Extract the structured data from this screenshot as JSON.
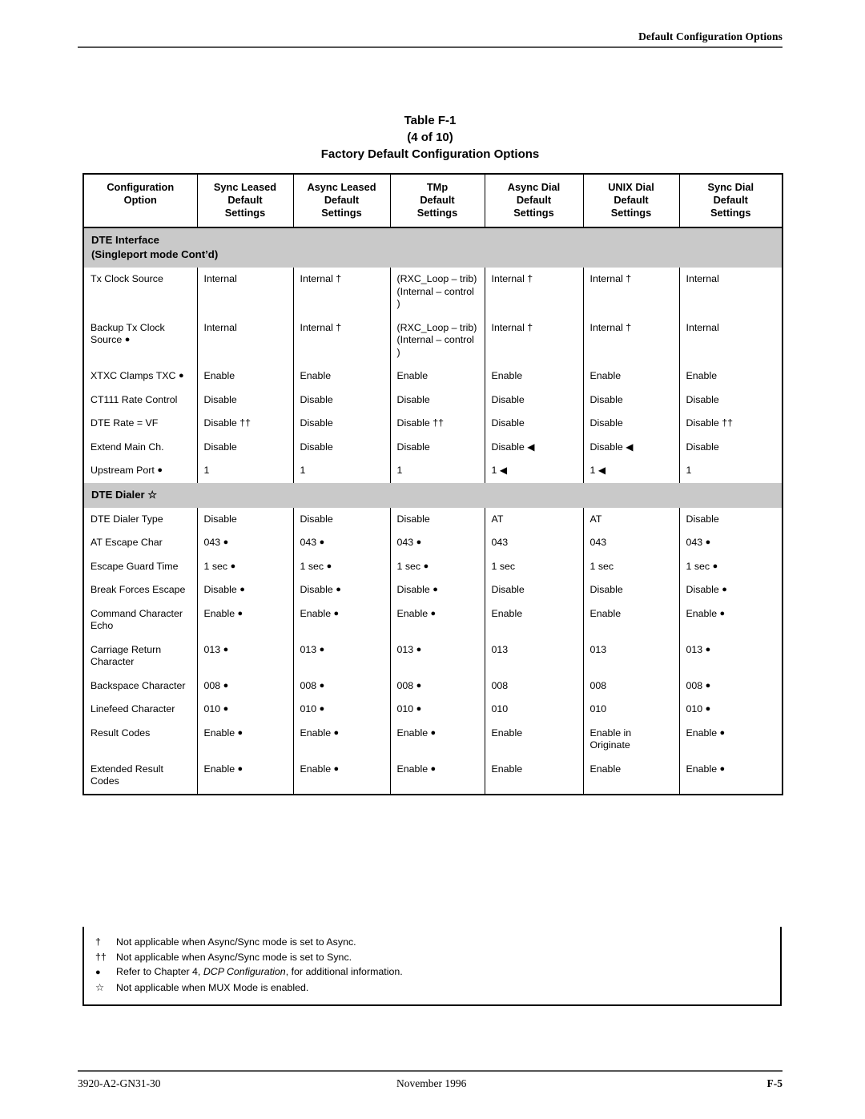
{
  "page": {
    "running_header": "Default Configuration Options",
    "footer": {
      "doc_number": "3920-A2-GN31-30",
      "date": "November 1996",
      "page_number": "F-5"
    }
  },
  "table": {
    "title_line1": "Table F-1",
    "title_line2": "(4 of 10)",
    "title_line3": "Factory Default Configuration Options",
    "columns": [
      "Configuration\nOption",
      "Sync Leased\nDefault\nSettings",
      "Async Leased\nDefault\nSettings",
      "TMp\nDefault\nSettings",
      "Async Dial\nDefault\nSettings",
      "UNIX Dial\nDefault\nSettings",
      "Sync Dial\nDefault\nSettings"
    ],
    "columns_flat": [
      {
        "l1": "Configuration",
        "l2": "Option",
        "l3": ""
      },
      {
        "l1": "Sync Leased",
        "l2": "Default",
        "l3": "Settings"
      },
      {
        "l1": "Async Leased",
        "l2": "Default",
        "l3": "Settings"
      },
      {
        "l1": "TMp",
        "l2": "Default",
        "l3": "Settings"
      },
      {
        "l1": "Async Dial",
        "l2": "Default",
        "l3": "Settings"
      },
      {
        "l1": "UNIX Dial",
        "l2": "Default",
        "l3": "Settings"
      },
      {
        "l1": "Sync Dial",
        "l2": "Default",
        "l3": "Settings"
      }
    ],
    "sections": [
      {
        "heading_line1": "DTE Interface",
        "heading_line2": "(Singleport mode Cont’d)",
        "rows": [
          {
            "option": "Tx Clock Source",
            "cells": [
              "Internal",
              "Internal †",
              "(RXC_Loop – trib)\n(Internal – control )",
              "Internal †",
              "Internal †",
              "Internal"
            ]
          },
          {
            "option": "Backup Tx Clock Source ●",
            "cells": [
              "Internal",
              "Internal †",
              "(RXC_Loop – trib)\n(Internal – control )",
              "Internal †",
              "Internal †",
              "Internal"
            ]
          },
          {
            "option": "XTXC Clamps TXC ●",
            "cells": [
              "Enable",
              "Enable",
              "Enable",
              "Enable",
              "Enable",
              "Enable"
            ]
          },
          {
            "option": "CT111 Rate Control",
            "cells": [
              "Disable",
              "Disable",
              "Disable",
              "Disable",
              "Disable",
              "Disable"
            ]
          },
          {
            "option": "DTE Rate = VF",
            "cells": [
              "Disable ††",
              "Disable",
              "Disable ††",
              "Disable",
              "Disable",
              "Disable ††"
            ]
          },
          {
            "option": "Extend Main Ch.",
            "cells": [
              "Disable",
              "Disable",
              "Disable",
              "Disable ◀",
              "Disable ◀",
              "Disable"
            ]
          },
          {
            "option": "Upstream Port ●",
            "cells": [
              "1",
              "1",
              "1",
              "1 ◀",
              "1 ◀",
              "1"
            ]
          }
        ]
      },
      {
        "heading_line1": "DTE Dialer ☆",
        "heading_line2": "",
        "rows": [
          {
            "option": "DTE Dialer Type",
            "cells": [
              "Disable",
              "Disable",
              "Disable",
              "AT",
              "AT",
              "Disable"
            ]
          },
          {
            "option": "AT Escape Char",
            "cells": [
              "043 ●",
              "043 ●",
              "043 ●",
              "043",
              "043",
              "043 ●"
            ]
          },
          {
            "option": "Escape Guard Time",
            "cells": [
              "1 sec ●",
              "1 sec ●",
              "1 sec ●",
              "1 sec",
              "1 sec",
              "1 sec ●"
            ]
          },
          {
            "option": "Break Forces Escape",
            "cells": [
              "Disable ●",
              "Disable ●",
              "Disable ●",
              "Disable",
              "Disable",
              "Disable ●"
            ]
          },
          {
            "option": "Command Character Echo",
            "cells": [
              "Enable ●",
              "Enable ●",
              "Enable ●",
              "Enable",
              "Enable",
              "Enable ●"
            ]
          },
          {
            "option": "Carriage Return Character",
            "cells": [
              "013 ●",
              "013 ●",
              "013 ●",
              "013",
              "013",
              "013 ●"
            ]
          },
          {
            "option": "Backspace Character",
            "cells": [
              "008 ●",
              "008 ●",
              "008 ●",
              "008",
              "008",
              "008 ●"
            ]
          },
          {
            "option": "Linefeed Character",
            "cells": [
              "010 ●",
              "010 ●",
              "010 ●",
              "010",
              "010",
              "010 ●"
            ]
          },
          {
            "option": "Result Codes",
            "cells": [
              "Enable ●",
              "Enable ●",
              "Enable ●",
              "Enable",
              "Enable in Originate",
              "Enable ●"
            ]
          },
          {
            "option": "Extended Result Codes",
            "cells": [
              "Enable ●",
              "Enable ●",
              "Enable ●",
              "Enable",
              "Enable",
              "Enable ●"
            ]
          }
        ]
      }
    ],
    "footnotes": [
      {
        "mark": "†",
        "text": "Not applicable when Async/Sync mode is set to Async."
      },
      {
        "mark": "††",
        "text": "Not applicable when Async/Sync mode is set to Sync."
      },
      {
        "mark": "●",
        "text_before": "Refer to Chapter 4, ",
        "text_italic": "DCP Configuration",
        "text_after": ", for additional information."
      },
      {
        "mark": "☆",
        "text": "Not applicable when MUX Mode is enabled."
      }
    ]
  }
}
